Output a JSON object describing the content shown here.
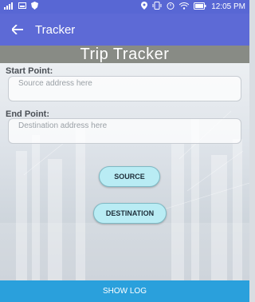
{
  "status_bar": {
    "time": "12:05 PM",
    "icons": [
      "signal-icon",
      "image-icon",
      "shield-icon",
      "location-icon",
      "vibrate-icon",
      "alarm-icon",
      "wifi-icon",
      "battery-icon"
    ]
  },
  "app_bar": {
    "title": "Tracker"
  },
  "banner": {
    "title": "Trip Tracker"
  },
  "form": {
    "start_label": "Start Point:",
    "start_placeholder": "Source address here",
    "end_label": "End Point:",
    "end_placeholder": "Destination address here"
  },
  "buttons": {
    "source": "SOURCE",
    "destination": "DESTINATION",
    "show_log": "SHOW LOG"
  },
  "colors": {
    "status_bar": "#5867d4",
    "app_bar": "#5d6ad6",
    "banner": "#888b85",
    "pill": "#b9ecf4",
    "bottom_button": "#2aa0dc"
  }
}
